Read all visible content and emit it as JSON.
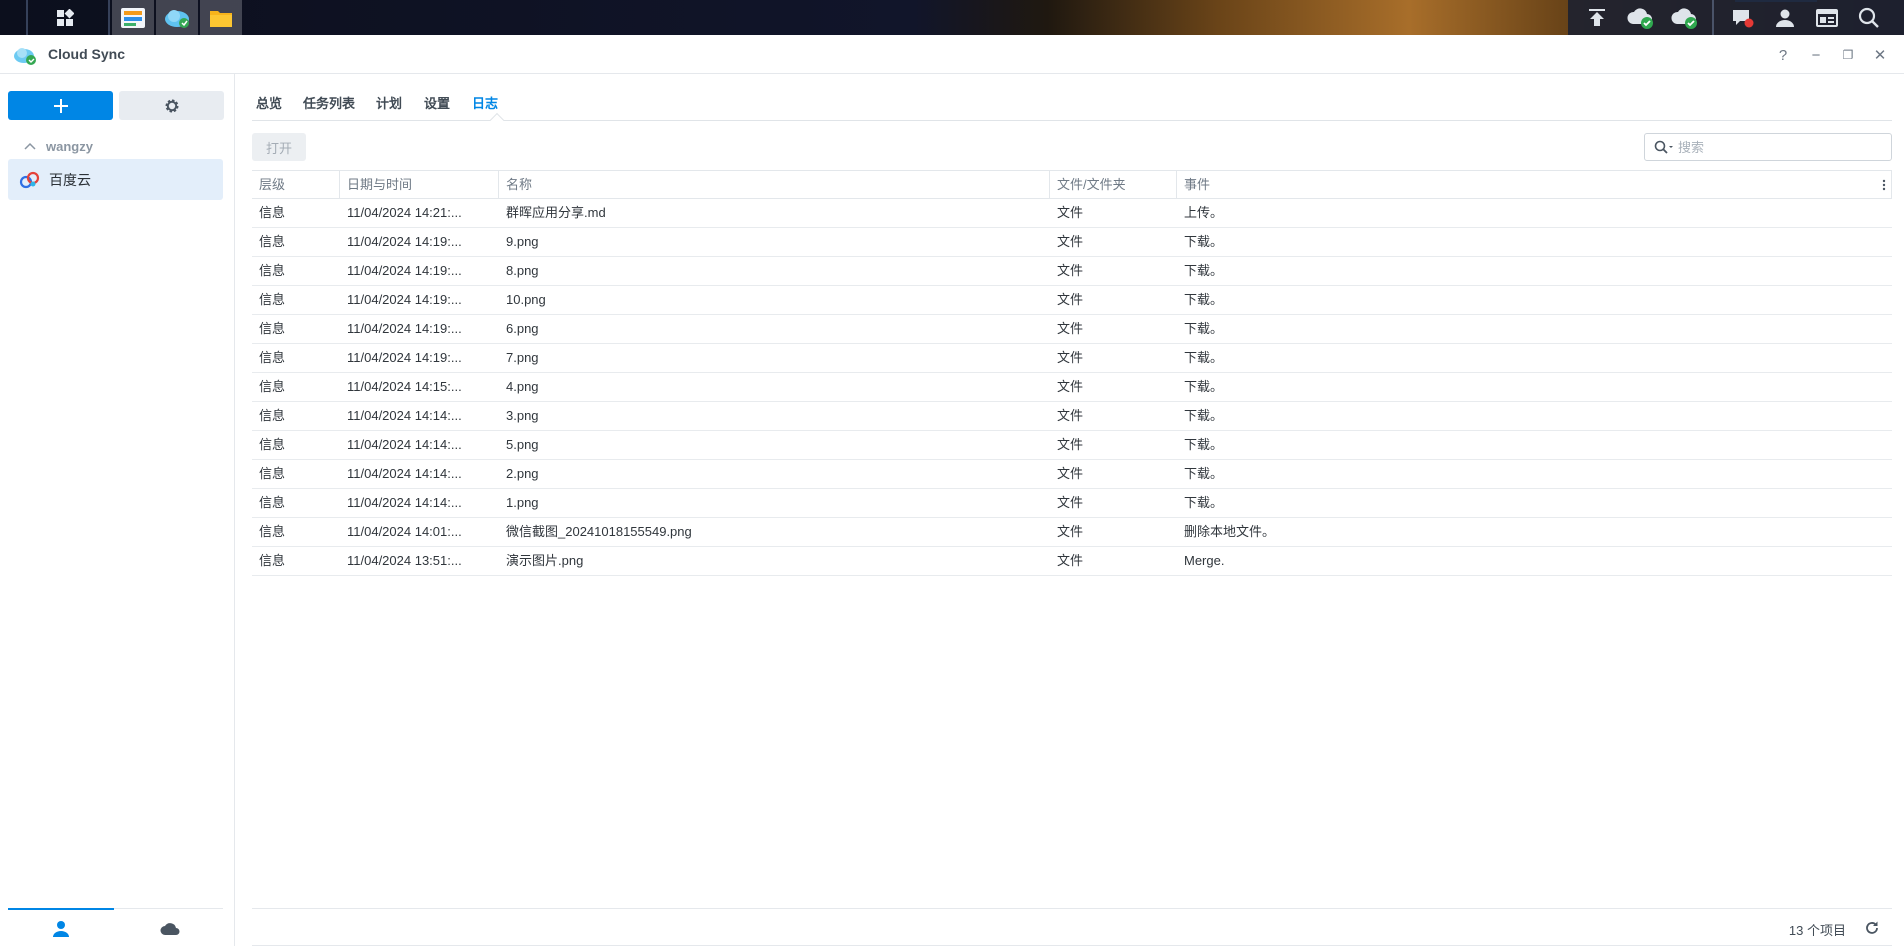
{
  "taskbar": {
    "apps": [
      {
        "name": "main-menu-icon"
      },
      {
        "name": "storage-manager-app-icon"
      },
      {
        "name": "cloud-sync-app-icon"
      },
      {
        "name": "file-station-app-icon"
      }
    ],
    "tray": [
      {
        "name": "upload-queue-icon"
      },
      {
        "name": "cloud-sync-status-icon"
      },
      {
        "name": "cloud-sync-status-icon-2"
      },
      {
        "name": "notifications-icon"
      },
      {
        "name": "user-icon"
      },
      {
        "name": "widgets-icon"
      },
      {
        "name": "search-icon"
      }
    ]
  },
  "window": {
    "title": "Cloud Sync",
    "controls": {
      "help": "?",
      "minimize": "−",
      "restore": "❐",
      "close": "✕"
    }
  },
  "sidebar": {
    "group_label": "wangzy",
    "items": [
      {
        "label": "百度云"
      }
    ]
  },
  "tabs": [
    "总览",
    "任务列表",
    "计划",
    "设置",
    "日志"
  ],
  "active_tab": "日志",
  "toolbar": {
    "open_label": "打开",
    "search_placeholder": "搜索"
  },
  "table": {
    "columns": [
      "层级",
      "日期与时间",
      "名称",
      "文件/文件夹",
      "事件"
    ],
    "rows": [
      [
        "信息",
        "11/04/2024 14:21:...",
        "群晖应用分享.md",
        "文件",
        "上传。"
      ],
      [
        "信息",
        "11/04/2024 14:19:...",
        "9.png",
        "文件",
        "下载。"
      ],
      [
        "信息",
        "11/04/2024 14:19:...",
        "8.png",
        "文件",
        "下载。"
      ],
      [
        "信息",
        "11/04/2024 14:19:...",
        "10.png",
        "文件",
        "下载。"
      ],
      [
        "信息",
        "11/04/2024 14:19:...",
        "6.png",
        "文件",
        "下载。"
      ],
      [
        "信息",
        "11/04/2024 14:19:...",
        "7.png",
        "文件",
        "下载。"
      ],
      [
        "信息",
        "11/04/2024 14:15:...",
        "4.png",
        "文件",
        "下载。"
      ],
      [
        "信息",
        "11/04/2024 14:14:...",
        "3.png",
        "文件",
        "下载。"
      ],
      [
        "信息",
        "11/04/2024 14:14:...",
        "5.png",
        "文件",
        "下载。"
      ],
      [
        "信息",
        "11/04/2024 14:14:...",
        "2.png",
        "文件",
        "下载。"
      ],
      [
        "信息",
        "11/04/2024 14:14:...",
        "1.png",
        "文件",
        "下载。"
      ],
      [
        "信息",
        "11/04/2024 14:01:...",
        "微信截图_20241018155549.png",
        "文件",
        "删除本地文件。"
      ],
      [
        "信息",
        "11/04/2024 13:51:...",
        "演示图片.png",
        "文件",
        "Merge."
      ]
    ]
  },
  "status": {
    "item_count": "13 个项目"
  },
  "colors": {
    "accent": "#0086e5",
    "selected_bg": "#e3eefa",
    "taskbar": "#0c0f1d"
  }
}
